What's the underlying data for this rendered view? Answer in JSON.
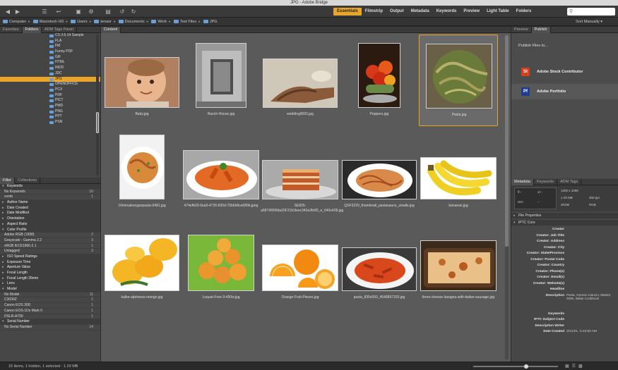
{
  "window": {
    "title": "JPG - Adobe Bridge"
  },
  "toolbar": {
    "workspaces": [
      "Essentials",
      "Filmstrip",
      "Output",
      "Metadata",
      "Keywords",
      "Preview",
      "Light Table",
      "Folders"
    ],
    "search_placeholder": "",
    "icons": [
      "back-icon",
      "forward-icon",
      "recent-icon",
      "return-icon",
      "camera-icon",
      "refine-icon",
      "open-icon",
      "rotate-left-icon",
      "rotate-right-icon"
    ]
  },
  "path": {
    "crumbs": [
      "Computer",
      "Macintosh HD",
      "Users",
      "tenaor",
      "Documents",
      "Work",
      "Test Files",
      "JPG"
    ],
    "sort_label": "Sort Manually"
  },
  "left": {
    "top_tabs": [
      "Favorites",
      "Folders",
      "ADM Tags Panel"
    ],
    "folders": [
      "CS 3.5.14 Sample",
      "FLA",
      "FM",
      "Funny PDF",
      "GIF",
      "HTML",
      "INDD",
      "JDC",
      "JPG",
      "OPENOFFICE",
      "PCX",
      "PDF",
      "PICT",
      "PMD",
      "PNG",
      "PPT",
      "PSN"
    ],
    "selected_folder": "JPG",
    "bottom_tabs": [
      "Filter",
      "Collections"
    ],
    "filters": [
      {
        "label": "Keywords",
        "cat": true,
        "open": true
      },
      {
        "label": "No Keywords",
        "count": "10"
      },
      {
        "label": "vvmb",
        "count": "1"
      },
      {
        "label": "Author Name",
        "cat": true
      },
      {
        "label": "Date Created",
        "cat": true
      },
      {
        "label": "Date Modified",
        "cat": true
      },
      {
        "label": "Orientation",
        "cat": true
      },
      {
        "label": "Aspect Ratio",
        "cat": true
      },
      {
        "label": "Color Profile",
        "cat": true,
        "open": true
      },
      {
        "label": "Adobe RGB (1998)",
        "count": "2"
      },
      {
        "label": "Grayscale - Gamma 2.2",
        "count": "3"
      },
      {
        "label": "sRGB IEC61966-2.1",
        "count": "1"
      },
      {
        "label": "Untagged",
        "count": "2"
      },
      {
        "label": "ISO Speed Ratings",
        "cat": true
      },
      {
        "label": "Exposure Time",
        "cat": true
      },
      {
        "label": "Aperture Value",
        "cat": true
      },
      {
        "label": "Focal Length",
        "cat": true
      },
      {
        "label": "Focal Length 35mm",
        "cat": true
      },
      {
        "label": "Lens",
        "cat": true
      },
      {
        "label": "Model",
        "cat": true,
        "open": true
      },
      {
        "label": "No Model",
        "count": "11"
      },
      {
        "label": "C3030Z",
        "count": "1"
      },
      {
        "label": "Canon EOS 30D",
        "count": "1"
      },
      {
        "label": "Canon EOS-1Ds Mark II",
        "count": "1"
      },
      {
        "label": "DSLR-A700",
        "count": "1"
      },
      {
        "label": "Serial Number",
        "cat": true,
        "open": true
      },
      {
        "label": "No Serial Number",
        "count": "14"
      }
    ]
  },
  "content": {
    "tab": "Content",
    "items": [
      {
        "name": "Baby.jpg",
        "kind": "baby"
      },
      {
        "name": "Ranch-House.jpg",
        "kind": "ranch"
      },
      {
        "name": "wedding9093.jpg",
        "kind": "wedding"
      },
      {
        "name": "Peppers.jpg",
        "kind": "peppers"
      },
      {
        "name": "Pasta.jpg",
        "kind": "pasta",
        "selected": true
      },
      {
        "name": "10minuteveganpasta-6481.jpg",
        "kind": "vegan"
      },
      {
        "name": "474efb03-6ea0-4726-835d-75b6b8ce689b.jpeg",
        "kind": "penne"
      },
      {
        "name": "SE826-a5874900fda20F21fc9eec343e3fe85_e_640x428.jpg",
        "kind": "lasagna"
      },
      {
        "name": "QSF3229_thumbnail_pastasauce_smalls.jpg",
        "kind": "spaghetti"
      },
      {
        "name": "bananas.jpg",
        "kind": "bananas"
      },
      {
        "name": "kalbe-alphonso-mango.jpg",
        "kind": "mango"
      },
      {
        "name": "Loquat-Free-3-450w.jpg",
        "kind": "loquat"
      },
      {
        "name": "Orange-Fruit-Pieces.jpg",
        "kind": "orange"
      },
      {
        "name": "pasta_835x550_4546897320.jpg",
        "kind": "penne2"
      },
      {
        "name": "three-cheese-lasagna-with-italian-sausage.jpg",
        "kind": "lasagna2"
      }
    ]
  },
  "right": {
    "top_tabs": [
      "Preview",
      "Publish"
    ],
    "publish_title": "Publish Files to...",
    "publish_items": [
      {
        "label": "Adobe Stock Contributor",
        "badge": "St",
        "color": "#d4401f"
      },
      {
        "label": "Adobe Portfolio",
        "badge": "Pf",
        "color": "#1b3f8c"
      }
    ],
    "meta_tabs": [
      "Metadata",
      "Keywords",
      "ADM Tags"
    ],
    "camera": {
      "a": "f/--",
      "b": "1/--",
      "c": "ISO",
      "d": "--",
      "size": "1200 x 1098",
      "mb": "1.29 MB",
      "dpi": "300 ppi",
      "mode": "sRGB",
      "space": "RGB"
    },
    "sections": [
      "File Properties",
      "IPTC Core"
    ],
    "iptc": [
      {
        "k": "Creator",
        "v": ""
      },
      {
        "k": "Creator: Job Title",
        "v": ""
      },
      {
        "k": "Creator: Address",
        "v": ""
      },
      {
        "k": "Creator: City",
        "v": ""
      },
      {
        "k": "Creator: State/Province",
        "v": ""
      },
      {
        "k": "Creator: Postal Code",
        "v": ""
      },
      {
        "k": "Creator: Country",
        "v": ""
      },
      {
        "k": "Creator: Phone(s)",
        "v": ""
      },
      {
        "k": "Creator: Email(s)",
        "v": ""
      },
      {
        "k": "Creator: Website(s)",
        "v": ""
      },
      {
        "k": "Headline",
        "v": ""
      }
    ],
    "description": {
      "k": "Description",
      "v": "Pasta, Antonio Gianoni, Market, 2005, Italian Cookbook"
    },
    "iptc_tail": [
      {
        "k": "Keywords",
        "v": ""
      },
      {
        "k": "IPTC Subject Code",
        "v": ""
      },
      {
        "k": "Description Writer",
        "v": ""
      },
      {
        "k": "Date Created",
        "v": "3/21/01, 4:43:50 AM"
      }
    ]
  },
  "status": {
    "text": "15 items, 1 hidden, 1 selected - 1.29 MB"
  }
}
